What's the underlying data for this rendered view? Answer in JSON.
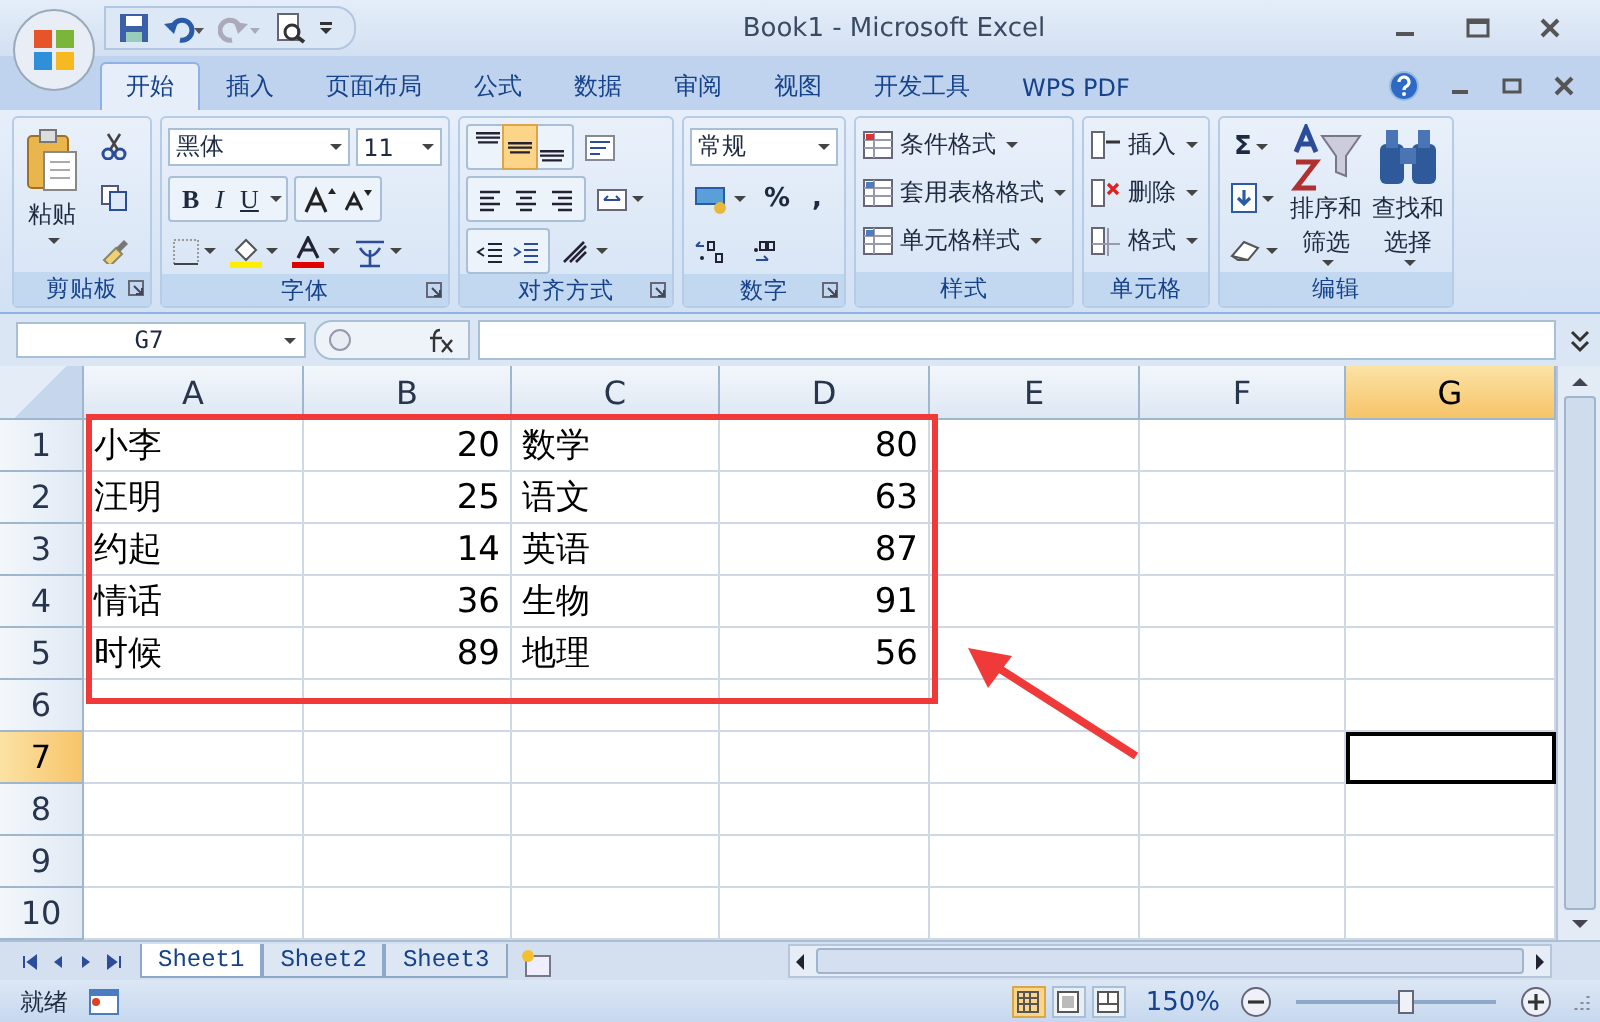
{
  "window": {
    "title": "Book1 - Microsoft Excel"
  },
  "tabs": [
    {
      "label": "开始",
      "selected": true
    },
    {
      "label": "插入",
      "selected": false
    },
    {
      "label": "页面布局",
      "selected": false
    },
    {
      "label": "公式",
      "selected": false
    },
    {
      "label": "数据",
      "selected": false
    },
    {
      "label": "审阅",
      "selected": false
    },
    {
      "label": "视图",
      "selected": false
    },
    {
      "label": "开发工具",
      "selected": false
    },
    {
      "label": "WPS PDF",
      "selected": false
    }
  ],
  "ribbon": {
    "clipboard": {
      "label": "剪贴板",
      "paste": "粘贴"
    },
    "font": {
      "label": "字体",
      "font_name": "黑体",
      "font_size": "11",
      "styles": [
        {
          "kind": "bold",
          "text": "B"
        },
        {
          "kind": "italic",
          "text": "I"
        },
        {
          "kind": "underline",
          "text": "U"
        }
      ]
    },
    "alignment": {
      "label": "对齐方式",
      "vertical": [
        {
          "kind": "top",
          "selected": false
        },
        {
          "kind": "middle",
          "selected": true
        },
        {
          "kind": "bottom",
          "selected": false
        }
      ]
    },
    "number": {
      "label": "数字",
      "format": "常规",
      "percent": "%",
      "comma": ","
    },
    "styles": {
      "label": "样式",
      "items": [
        "条件格式",
        "套用表格格式",
        "单元格样式"
      ]
    },
    "cells": {
      "label": "单元格",
      "items": [
        "插入",
        "删除",
        "格式"
      ]
    },
    "editing": {
      "label": "编辑",
      "sum": "Σ",
      "sort": "排序和筛选",
      "find": "查找和选择"
    }
  },
  "formula_bar": {
    "name_box": "G7"
  },
  "grid": {
    "columns": [
      {
        "label": "A",
        "selected": false
      },
      {
        "label": "B",
        "selected": false
      },
      {
        "label": "C",
        "selected": false
      },
      {
        "label": "D",
        "selected": false
      },
      {
        "label": "E",
        "selected": false
      },
      {
        "label": "F",
        "selected": false
      },
      {
        "label": "G",
        "selected": true
      }
    ],
    "rows": [
      {
        "header": "1",
        "selected": false,
        "cells": [
          {
            "text": "小李",
            "kind": "text"
          },
          {
            "text": "20",
            "kind": "number"
          },
          {
            "text": "数学",
            "kind": "text"
          },
          {
            "text": "80",
            "kind": "number"
          }
        ]
      },
      {
        "header": "2",
        "selected": false,
        "cells": [
          {
            "text": "汪明",
            "kind": "text"
          },
          {
            "text": "25",
            "kind": "number"
          },
          {
            "text": "语文",
            "kind": "text"
          },
          {
            "text": "63",
            "kind": "number"
          }
        ]
      },
      {
        "header": "3",
        "selected": false,
        "cells": [
          {
            "text": "约起",
            "kind": "text"
          },
          {
            "text": "14",
            "kind": "number"
          },
          {
            "text": "英语",
            "kind": "text"
          },
          {
            "text": "87",
            "kind": "number"
          }
        ]
      },
      {
        "header": "4",
        "selected": false,
        "cells": [
          {
            "text": "情话",
            "kind": "text"
          },
          {
            "text": "36",
            "kind": "number"
          },
          {
            "text": "生物",
            "kind": "text"
          },
          {
            "text": "91",
            "kind": "number"
          }
        ]
      },
      {
        "header": "5",
        "selected": false,
        "cells": [
          {
            "text": "时候",
            "kind": "text"
          },
          {
            "text": "89",
            "kind": "number"
          },
          {
            "text": "地理",
            "kind": "text"
          },
          {
            "text": "56",
            "kind": "number"
          }
        ]
      },
      {
        "header": "6",
        "selected": false,
        "cells": []
      },
      {
        "header": "7",
        "selected": true,
        "cells": []
      },
      {
        "header": "8",
        "selected": false,
        "cells": []
      },
      {
        "header": "9",
        "selected": false,
        "cells": []
      },
      {
        "header": "10",
        "selected": false,
        "cells": []
      }
    ]
  },
  "sheets": [
    {
      "label": "Sheet1",
      "selected": true
    },
    {
      "label": "Sheet2",
      "selected": false
    },
    {
      "label": "Sheet3",
      "selected": false
    }
  ],
  "status_bar": {
    "status": "就绪",
    "views": [
      {
        "kind": "normal",
        "selected": true
      },
      {
        "kind": "layout",
        "selected": false
      },
      {
        "kind": "pagebreak",
        "selected": false
      }
    ],
    "zoom": "150%",
    "zoom_slider": {
      "level": 0.55
    }
  }
}
